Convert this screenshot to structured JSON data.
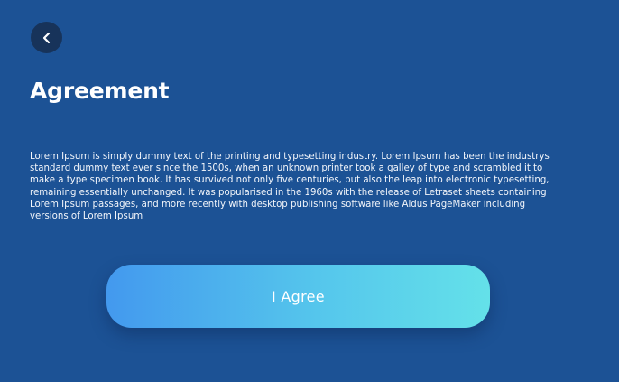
{
  "header": {
    "back_icon": "chevron-left-icon",
    "title": "Agreement"
  },
  "content": {
    "body": "Lorem Ipsum is simply dummy text of the printing and typesetting industry. Lorem Ipsum has been the industrys standard dummy text ever since the 1500s, when an unknown printer took a galley of type and scrambled it to make a type specimen book. It has survived not only five centuries, but also the leap into electronic typesetting, remaining essentially unchanged. It was popularised in the 1960s with the release of Letraset sheets containing Lorem Ipsum passages, and more recently with desktop publishing software like Aldus PageMaker including versions of Lorem Ipsum"
  },
  "actions": {
    "agree_label": "I Agree"
  },
  "colors": {
    "background": "#1c5295",
    "back_button": "#17335a",
    "button_gradient_start": "#4399ee",
    "button_gradient_end": "#64e1e9"
  }
}
